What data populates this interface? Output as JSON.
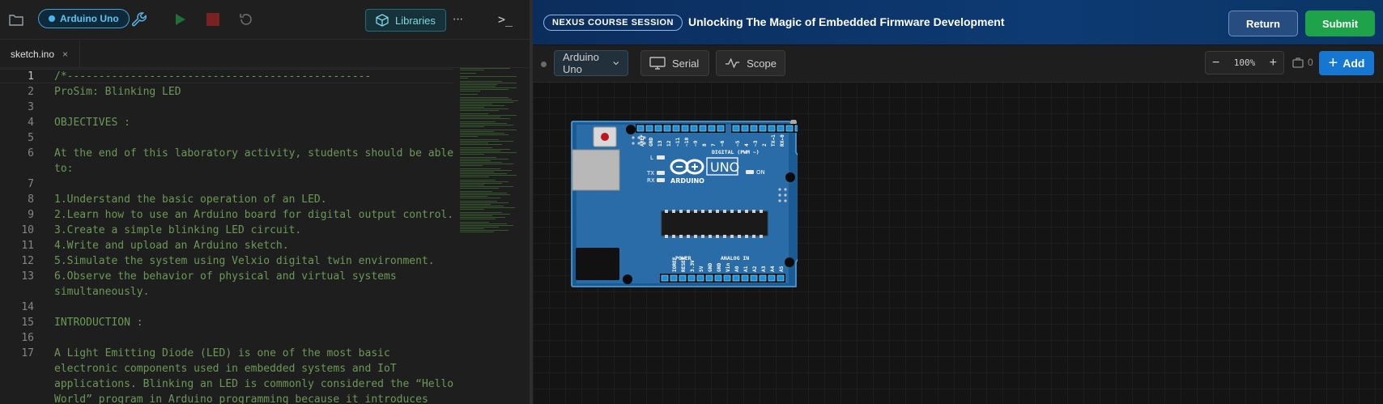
{
  "toolbar": {
    "board_name": "Arduino Uno",
    "libraries_label": "Libraries",
    "more_label": "···",
    "terminal_label": ">_"
  },
  "tabs": [
    {
      "label": "sketch.ino",
      "close": "×"
    }
  ],
  "editor": {
    "lines": [
      {
        "n": "1",
        "text": "/*------------------------------------------------"
      },
      {
        "n": "2",
        "text": "ProSim: Blinking LED"
      },
      {
        "n": "3",
        "text": ""
      },
      {
        "n": "4",
        "text": "OBJECTIVES :"
      },
      {
        "n": "5",
        "text": ""
      },
      {
        "n": "6",
        "text": "At the end of this laboratory activity, students should be able"
      },
      {
        "n": "",
        "text": "to:"
      },
      {
        "n": "7",
        "text": ""
      },
      {
        "n": "8",
        "text": "1.Understand the basic operation of an LED."
      },
      {
        "n": "9",
        "text": "2.Learn how to use an Arduino board for digital output control."
      },
      {
        "n": "10",
        "text": "3.Create a simple blinking LED circuit."
      },
      {
        "n": "11",
        "text": "4.Write and upload an Arduino sketch."
      },
      {
        "n": "12",
        "text": "5.Simulate the system using Velxio digital twin environment."
      },
      {
        "n": "13",
        "text": "6.Observe the behavior of physical and virtual systems"
      },
      {
        "n": "",
        "text": "simultaneously."
      },
      {
        "n": "14",
        "text": ""
      },
      {
        "n": "15",
        "text": "INTRODUCTION :"
      },
      {
        "n": "16",
        "text": ""
      },
      {
        "n": "17",
        "text": "A Light Emitting Diode (LED) is one of the most basic"
      },
      {
        "n": "",
        "text": "electronic components used in embedded systems and IoT"
      },
      {
        "n": "",
        "text": "applications. Blinking an LED is commonly considered the “Hello"
      },
      {
        "n": "",
        "text": "World” program in Arduino programming because it introduces"
      }
    ]
  },
  "banner": {
    "badge": "NEXUS COURSE SESSION",
    "title": "Unlocking The Magic of Embedded Firmware Development",
    "return_label": "Return",
    "submit_label": "Submit"
  },
  "sim_toolbar": {
    "board_select": "Arduino Uno",
    "serial_label": "Serial",
    "scope_label": "Scope",
    "zoom_minus": "−",
    "zoom_value": "100%",
    "zoom_plus": "+",
    "component_count": "0",
    "add_label": "Add"
  },
  "arduino": {
    "brand": "ARDUINO",
    "model": "UNO",
    "digital_label": "DIGITAL (PWM ~)",
    "power_label": "POWER",
    "analog_label": "ANALOG IN",
    "on_label": "ON",
    "l_label": "L",
    "tx_label": "TX",
    "rx_label": "RX",
    "digital_pins": [
      "AREF",
      "GND",
      "13",
      "12",
      "~11",
      "~10",
      "~9",
      "8",
      "7",
      "~6",
      "~5",
      "4",
      "~3",
      "2",
      "TX→1",
      "RX←0"
    ],
    "power_pins": [
      "IOREF",
      "RESET",
      "3.3V",
      "5V",
      "GND",
      "GND",
      "Vin"
    ],
    "analog_pins": [
      "A0",
      "A1",
      "A2",
      "A3",
      "A4",
      "A5"
    ]
  },
  "colors": {
    "accent": "#1677d2",
    "submit": "#1fa34a",
    "banner": "#0d3a73",
    "code_comment": "#6a9955",
    "board_blue": "#2a6ca8"
  }
}
